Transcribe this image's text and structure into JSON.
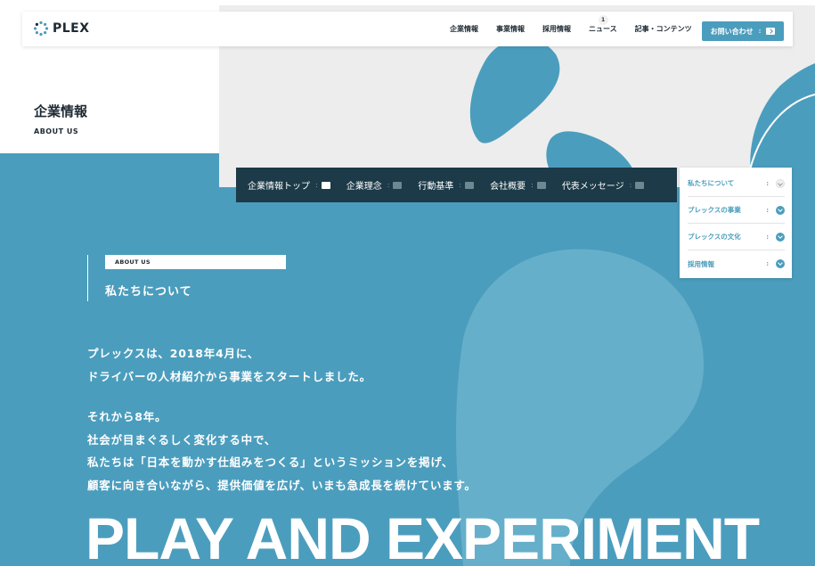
{
  "logo": {
    "text": "PLEX"
  },
  "nav": {
    "items": [
      {
        "label": "企業情報"
      },
      {
        "label": "事業情報"
      },
      {
        "label": "採用情報"
      },
      {
        "label": "ニュース",
        "badge": "1"
      },
      {
        "label": "記事・コンテンツ"
      }
    ],
    "contact_label": "お問い合わせ"
  },
  "page": {
    "title": "企業情報",
    "subtitle": "ABOUT US"
  },
  "subnav": {
    "items": [
      {
        "label": "企業情報トップ"
      },
      {
        "label": "企業理念"
      },
      {
        "label": "行動基準"
      },
      {
        "label": "会社概要"
      },
      {
        "label": "代表メッセージ"
      }
    ]
  },
  "side_panel": {
    "items": [
      {
        "label": "私たちについて"
      },
      {
        "label": "プレックスの事業"
      },
      {
        "label": "プレックスの文化"
      },
      {
        "label": "採用情報"
      }
    ]
  },
  "about": {
    "tag": "ABOUT US",
    "heading": "私たちについて",
    "para1": [
      "プレックスは、2018年4月に、",
      "ドライバーの人材紹介から事業をスタートしました。"
    ],
    "para2": [
      "それから8年。",
      "社会が目まぐるしく変化する中で、",
      "私たちは「日本を動かす仕組みをつくる」というミッションを掲げ、",
      "顧客に向き合いながら、提供価値を広げ、いまも急成長を続けています。"
    ],
    "big_title": "PLAY AND EXPERIMENT"
  },
  "colors": {
    "accent": "#4b9dbd",
    "dark": "#1c3a48",
    "text_dark": "#1d2a33"
  },
  "icons": [
    "logo-dots-icon",
    "arrow-right-icon",
    "chevron-down-icon"
  ]
}
